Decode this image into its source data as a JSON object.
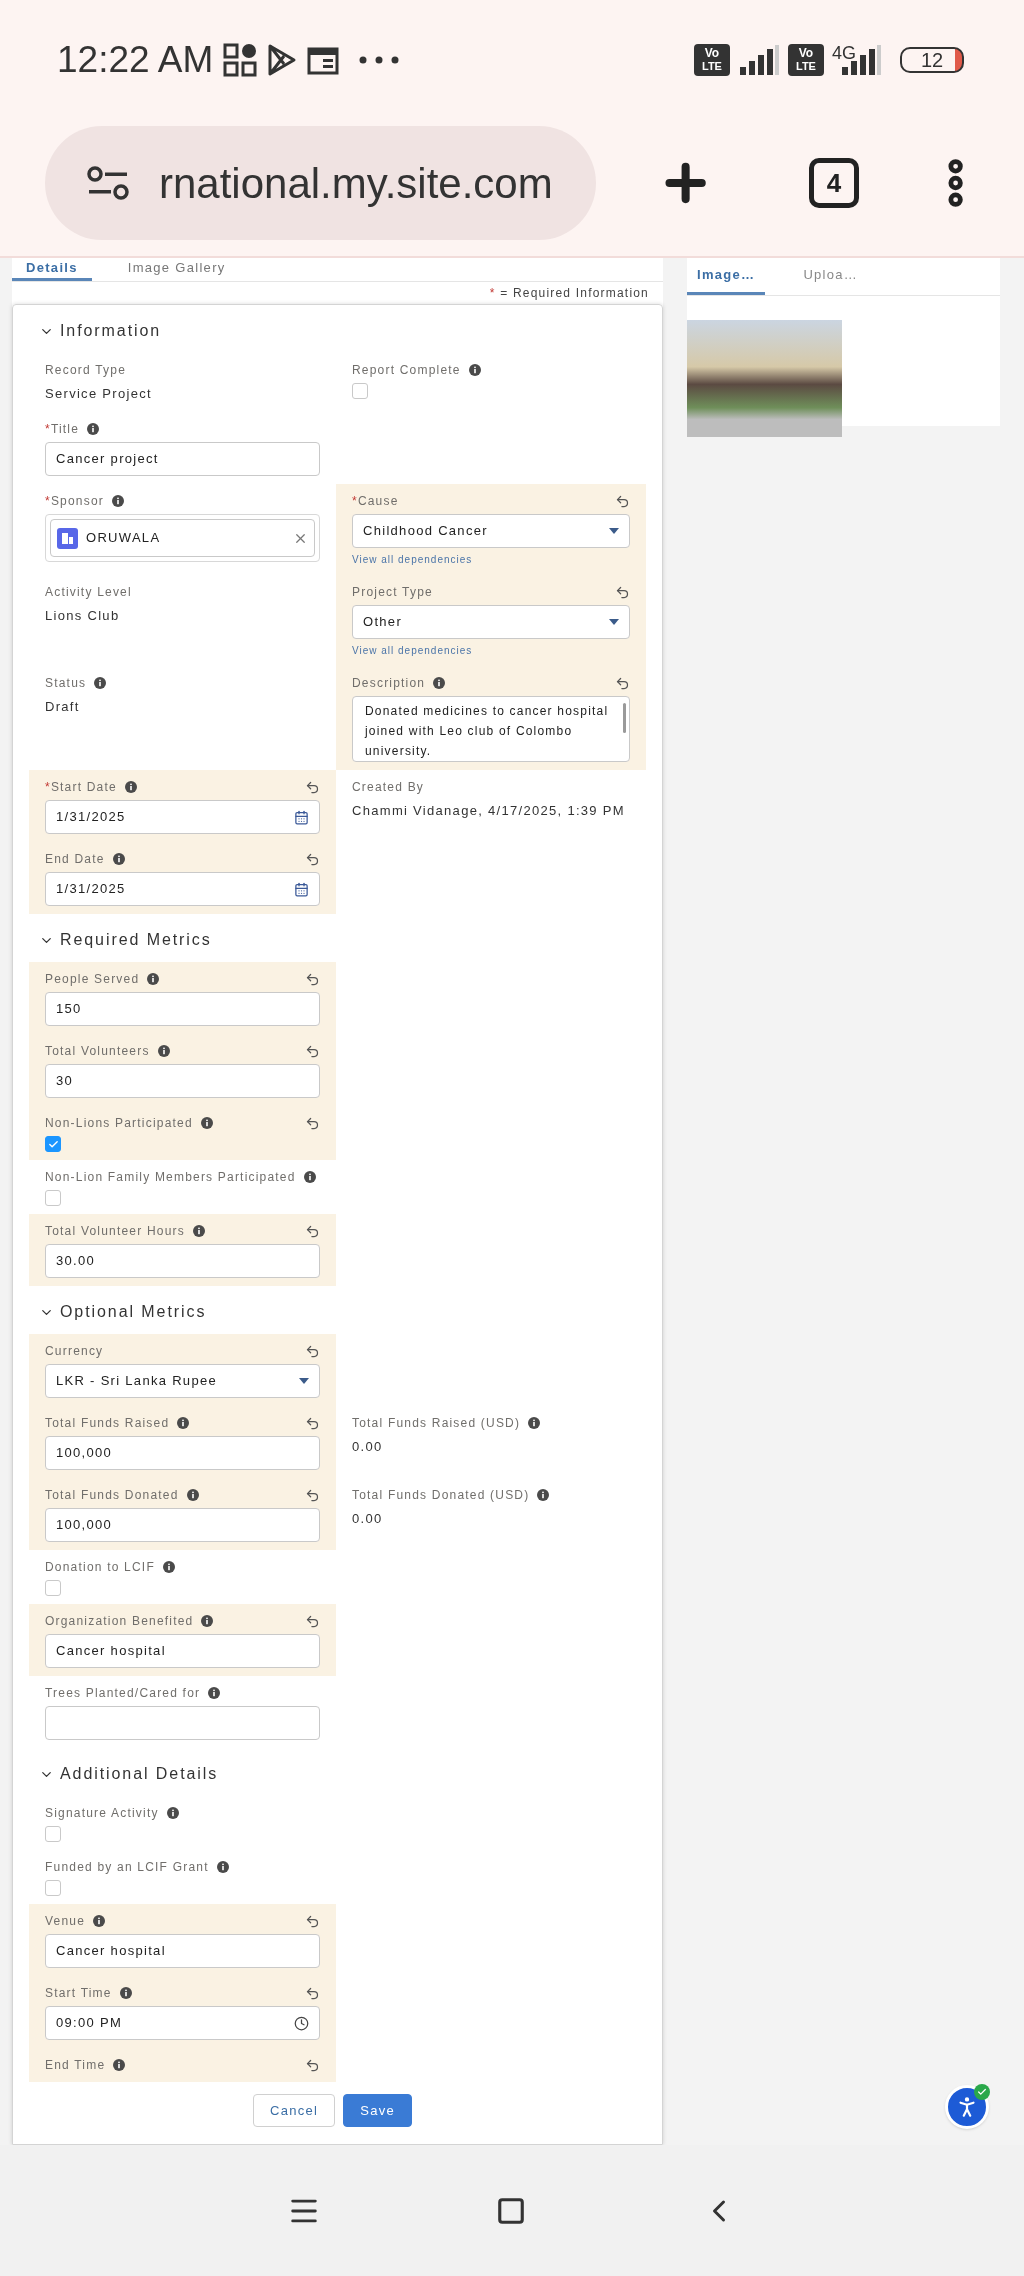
{
  "status_bar": {
    "time": "12:22 AM",
    "network_badges": [
      {
        "top": "Vo",
        "bottom": "LTE"
      },
      {
        "top": "Vo",
        "bottom": "LTE"
      }
    ],
    "network_type": "4G",
    "battery": "12"
  },
  "browser": {
    "url": "rnational.my.site.com",
    "tab_count": "4"
  },
  "tabs": [
    {
      "label": "Details",
      "selected": true
    },
    {
      "label": "Image Gallery",
      "selected": false
    }
  ],
  "legend": {
    "mark": "*",
    "text": "= Required Information"
  },
  "sections": [
    {
      "title": "Information",
      "expanded": true,
      "rows": [
        [
          {
            "kind": "output",
            "label": "Record Type",
            "value": "Service Project"
          },
          {
            "kind": "checkbox",
            "label": "Report Complete",
            "info": true,
            "checked": false
          }
        ],
        [
          {
            "kind": "input",
            "label": "Title",
            "marker": "*",
            "info": true,
            "value": "Cancer project"
          },
          null
        ],
        [
          {
            "kind": "lookup",
            "label": "Sponsor",
            "marker": "*",
            "info": true,
            "value": "ORUWALA"
          },
          {
            "kind": "select",
            "label": "Cause",
            "marker": "*",
            "changed": true,
            "value": "Childhood Cancer",
            "link": "View all dependencies"
          }
        ],
        [
          {
            "kind": "output",
            "label": "Activity Level",
            "value": "Lions Club"
          },
          {
            "kind": "select",
            "label": "Project Type",
            "changed": true,
            "value": "Other",
            "link": "View all dependencies"
          }
        ],
        [
          {
            "kind": "output",
            "label": "Status",
            "info": true,
            "value": "Draft"
          },
          {
            "kind": "textarea",
            "label": "Description",
            "info": true,
            "changed": true,
            "value": "Donated medicines to cancer hospital joined with Leo club of Colombo university."
          }
        ],
        [
          {
            "kind": "date",
            "label": "Start Date",
            "marker": "*",
            "info": true,
            "changed": true,
            "value": "1/31/2025"
          },
          {
            "kind": "output",
            "label": "Created By",
            "value": "Chammi Vidanage, 4/17/2025, 1:39 PM"
          }
        ],
        [
          {
            "kind": "date",
            "label": "End Date",
            "info": true,
            "changed": true,
            "value": "1/31/2025"
          },
          null
        ]
      ]
    },
    {
      "title": "Required Metrics",
      "expanded": true,
      "rows": [
        [
          {
            "kind": "input",
            "label": "People Served",
            "info": true,
            "changed": true,
            "value": "150"
          },
          null
        ],
        [
          {
            "kind": "input",
            "label": "Total Volunteers",
            "info": true,
            "changed": true,
            "value": "30"
          },
          null
        ],
        [
          {
            "kind": "checkbox",
            "label": "Non-Lions Participated",
            "info": true,
            "changed": true,
            "checked": true
          },
          null
        ],
        [
          {
            "kind": "checkbox",
            "label": "Non-Lion Family Members Participated",
            "info": true,
            "checked": false
          },
          null
        ],
        [
          {
            "kind": "input",
            "label": "Total Volunteer Hours",
            "info": true,
            "changed": true,
            "value": "30.00"
          },
          null
        ]
      ]
    },
    {
      "title": "Optional Metrics",
      "expanded": true,
      "rows": [
        [
          {
            "kind": "select",
            "label": "Currency",
            "changed": true,
            "value": "LKR - Sri Lanka Rupee"
          },
          null
        ],
        [
          {
            "kind": "input",
            "label": "Total Funds Raised",
            "info": true,
            "changed": true,
            "value": "100,000"
          },
          {
            "kind": "output",
            "label": "Total Funds Raised (USD)",
            "info": true,
            "value": "0.00"
          }
        ],
        [
          {
            "kind": "input",
            "label": "Total Funds Donated",
            "info": true,
            "changed": true,
            "value": "100,000"
          },
          {
            "kind": "output",
            "label": "Total Funds Donated (USD)",
            "info": true,
            "value": "0.00"
          }
        ],
        [
          {
            "kind": "checkbox",
            "label": "Donation to LCIF",
            "info": true,
            "checked": false
          },
          null
        ],
        [
          {
            "kind": "input",
            "label": "Organization Benefited",
            "info": true,
            "changed": true,
            "value": "Cancer hospital"
          },
          null
        ],
        [
          {
            "kind": "input",
            "label": "Trees Planted/Cared for",
            "info": true
          },
          null
        ]
      ]
    },
    {
      "title": "Additional Details",
      "expanded": true,
      "rows": [
        [
          {
            "kind": "checkbox",
            "label": "Signature Activity",
            "info": true,
            "checked": false
          },
          null
        ],
        [
          {
            "kind": "checkbox",
            "label": "Funded by an LCIF Grant",
            "info": true,
            "checked": false
          },
          null
        ],
        [
          {
            "kind": "input",
            "label": "Venue",
            "info": true,
            "changed": true,
            "value": "Cancer hospital"
          },
          null
        ],
        [
          {
            "kind": "time",
            "label": "Start Time",
            "info": true,
            "changed": true,
            "value": "09:00 PM"
          },
          null
        ],
        [
          {
            "kind": "label",
            "label": "End Time",
            "info": true,
            "changed": true
          },
          null
        ]
      ]
    }
  ],
  "footer": {
    "buttons": [
      {
        "label": "Cancel",
        "kind": "secondary"
      },
      {
        "label": "Save",
        "kind": "primary"
      }
    ]
  },
  "side_panel": {
    "tabs": [
      {
        "label": "Image…",
        "selected": true
      },
      {
        "label": "Uploa…",
        "selected": false
      }
    ]
  }
}
